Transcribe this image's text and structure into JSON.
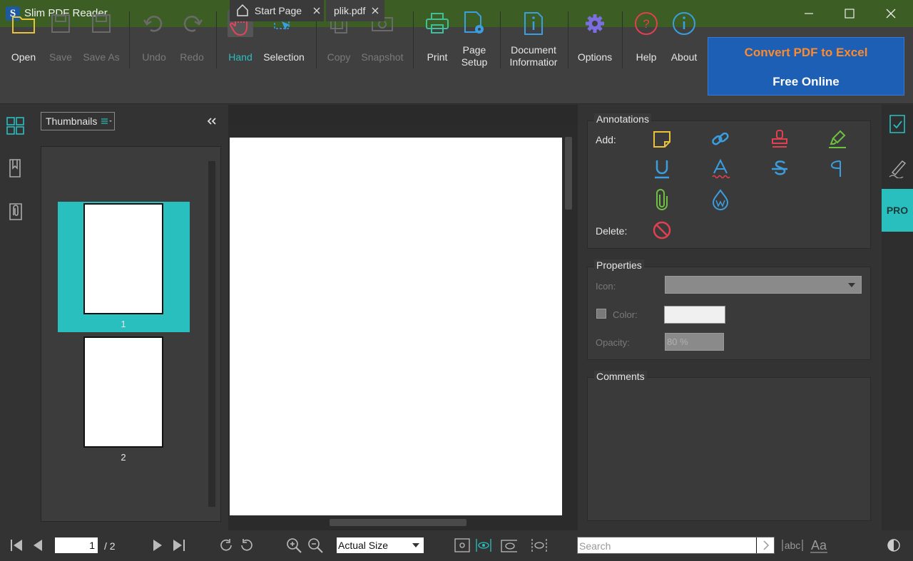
{
  "window": {
    "title": "Slim PDF Reader",
    "logo_letter": "S"
  },
  "toolbar": {
    "open": "Open",
    "save": "Save",
    "save_as": "Save As",
    "undo": "Undo",
    "redo": "Redo",
    "hand": "Hand",
    "selection": "Selection",
    "copy": "Copy",
    "snapshot": "Snapshot",
    "print": "Print",
    "page_setup_1": "Page",
    "page_setup_2": "Setup",
    "doc_info_1": "Document",
    "doc_info_2": "Informatior",
    "options": "Options",
    "help": "Help",
    "about": "About"
  },
  "promo": {
    "line1": "Convert PDF to Excel",
    "line2": "Free Online"
  },
  "thumbnails": {
    "dropdown": "Thumbnails",
    "pages": [
      {
        "label": "1"
      },
      {
        "label": "2"
      }
    ]
  },
  "tabs": [
    {
      "label": "Start Page"
    },
    {
      "label": "plik.pdf"
    }
  ],
  "annotations": {
    "title": "Annotations",
    "add_label": "Add:",
    "delete_label": "Delete:"
  },
  "properties": {
    "title": "Properties",
    "icon_label": "Icon:",
    "color_label": "Color:",
    "opacity_label": "Opacity:",
    "opacity_value": "80 %"
  },
  "comments": {
    "title": "Comments"
  },
  "side": {
    "pro": "PRO"
  },
  "status": {
    "current_page": "1",
    "total_pages": "/ 2",
    "zoom": "Actual Size",
    "search_placeholder": "Search"
  },
  "colors": {
    "titlebar": "#3c5d23",
    "accent": "#2abfbf",
    "promo_bg": "#1d5fb4",
    "promo_text": "#ff8a2a"
  }
}
